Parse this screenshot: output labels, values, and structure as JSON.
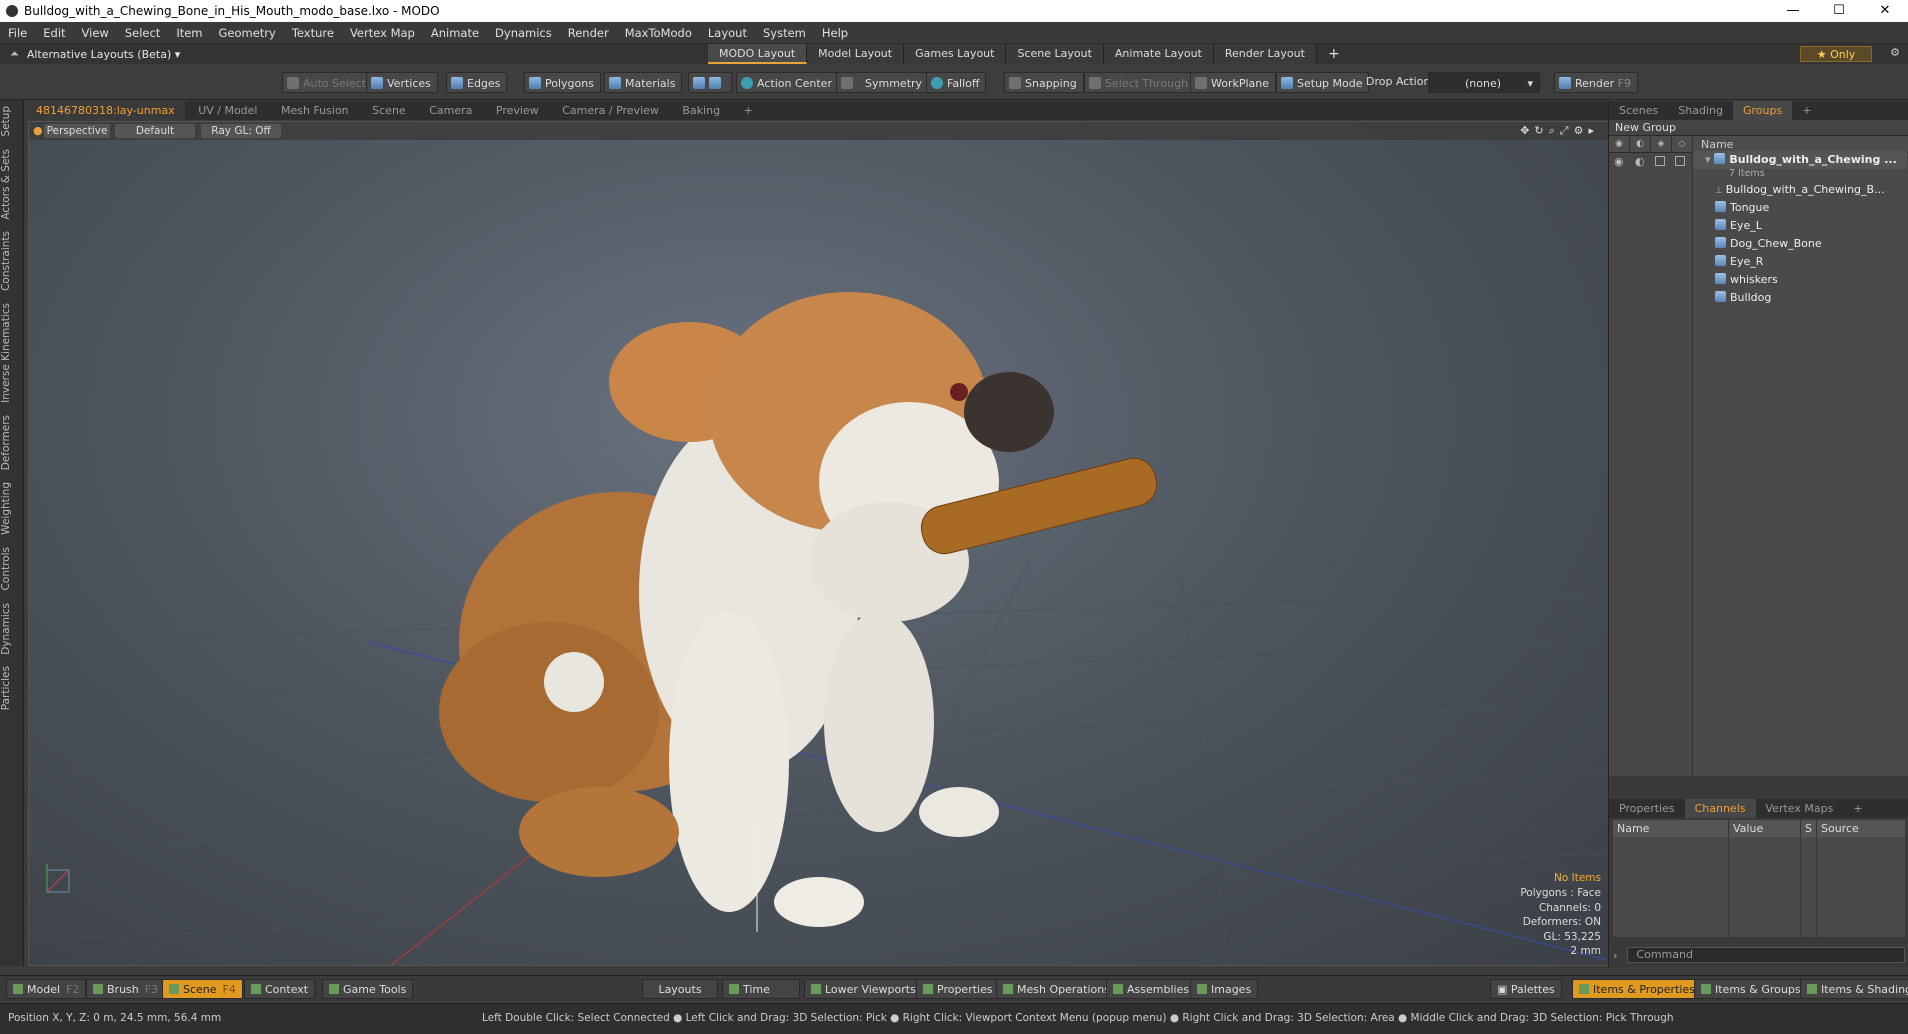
{
  "window": {
    "title": "Bulldog_with_a_Chewing_Bone_in_His_Mouth_modo_base.lxo - MODO"
  },
  "menu": [
    "File",
    "Edit",
    "View",
    "Select",
    "Item",
    "Geometry",
    "Texture",
    "Vertex Map",
    "Animate",
    "Dynamics",
    "Render",
    "MaxToModo",
    "Layout",
    "System",
    "Help"
  ],
  "layoutbar": {
    "alt_layouts": "Alternative Layouts (Beta) ▾",
    "tabs": [
      "MODO Layout",
      "Model Layout",
      "Games Layout",
      "Scene Layout",
      "Animate Layout",
      "Render Layout"
    ],
    "add": "+",
    "only": "★ Only"
  },
  "toolbar": {
    "auto_select": "Auto Select",
    "vertices": "Vertices",
    "edges": "Edges",
    "polygons": "Polygons",
    "materials": "Materials",
    "action_center": "Action Center",
    "symmetry": "Symmetry",
    "falloff": "Falloff",
    "snapping": "Snapping",
    "select_through": "Select Through",
    "workplane": "WorkPlane",
    "setup_mode": "Setup Mode",
    "drop_action": "Drop Action",
    "drop_value": "(none)",
    "render": "Render",
    "render_key": "F9"
  },
  "left_tabs": [
    "Setup",
    "Actors & Sets",
    "Constraints",
    "Inverse Kinematics",
    "Deformers",
    "Weighting",
    "Controls",
    "Dynamics",
    "Particles"
  ],
  "viewport_tabs": [
    "48146780318:lay-unmax",
    "UV / Model",
    "Mesh Fusion",
    "Scene",
    "Camera",
    "Preview",
    "Camera / Preview",
    "Baking",
    "+"
  ],
  "viewport": {
    "perspective": "Perspective",
    "default": "Default",
    "raygl": "Ray GL: Off",
    "hud": {
      "no_items": "No Items",
      "polygons": "Polygons : Face",
      "channels": "Channels: 0",
      "deformers": "Deformers: ON",
      "gl": "GL: 53,225",
      "scale": "2 mm"
    }
  },
  "right_tabs": [
    "Scenes",
    "Shading",
    "Groups",
    "+"
  ],
  "groups": {
    "new_group": "New Group",
    "name_header": "Name",
    "root": "Bulldog_with_a_Chewing ...",
    "root_sub": "7 Items",
    "items": [
      "Bulldog_with_a_Chewing_B...",
      "Tongue",
      "Eye_L",
      "Dog_Chew_Bone",
      "Eye_R",
      "whiskers",
      "Bulldog"
    ]
  },
  "channel_tabs": [
    "Properties",
    "Channels",
    "Vertex Maps",
    "+"
  ],
  "channel_headers": [
    "Name",
    "Value",
    "S",
    "Source"
  ],
  "command_placeholder": "Command",
  "bottom": {
    "model": "Model",
    "model_key": "F2",
    "brush": "Brush",
    "brush_key": "F3",
    "scene": "Scene",
    "scene_key": "F4",
    "context": "Context",
    "game_tools": "Game Tools",
    "layouts": "Layouts",
    "time": "Time",
    "lower_viewports": "Lower Viewports",
    "properties": "Properties",
    "mesh_operations": "Mesh Operations",
    "assemblies": "Assemblies",
    "images": "Images",
    "palettes": "Palettes",
    "items_properties": "Items & Properties",
    "items_groups": "Items & Groups",
    "items_shading": "Items & Shading"
  },
  "status": {
    "position": "Position X, Y, Z:   0 m, 24.5 mm, 56.4 mm",
    "hints": "Left Double Click: Select Connected ● Left Click and Drag: 3D Selection: Pick ● Right Click: Viewport Context Menu (popup menu) ● Right Click and Drag: 3D Selection: Area ● Middle Click and Drag: 3D Selection: Pick Through"
  }
}
